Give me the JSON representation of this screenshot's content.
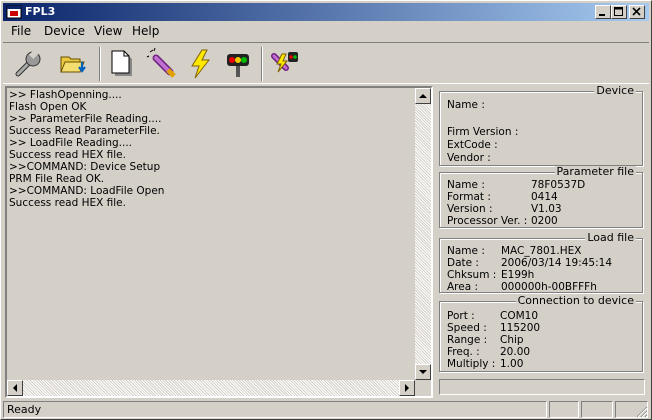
{
  "window": {
    "title": "FPL3"
  },
  "menu": {
    "file": "File",
    "device": "Device",
    "view": "View",
    "help": "Help"
  },
  "toolbar": {
    "buttons": [
      {
        "icon": "wrench-icon"
      },
      {
        "icon": "folder-open-icon"
      },
      {
        "icon": "blank-page-icon"
      },
      {
        "icon": "eraser-pen-icon"
      },
      {
        "icon": "lightning-icon"
      },
      {
        "icon": "traffic-light-icon"
      },
      {
        "icon": "auto-program-icon"
      }
    ]
  },
  "log": {
    "lines": [
      ">> FlashOpenning....",
      "Flash Open OK",
      ">> ParameterFile Reading....",
      "Success Read ParameterFile.",
      ">> LoadFile Reading....",
      "Success read HEX file.",
      ">>COMMAND: Device Setup",
      "PRM File Read OK.",
      ">>COMMAND: LoadFile Open",
      "Success read HEX file."
    ]
  },
  "device": {
    "legend": "Device",
    "name_label": "Name :",
    "firm_label": "Firm Version :",
    "extcode_label": "ExtCode :",
    "vendor_label": "Vendor :"
  },
  "parameter_file": {
    "legend": "Parameter file",
    "name_label": "Name :",
    "name": "78F0537D",
    "format_label": "Format :",
    "format": "0414",
    "version_label": "Version :",
    "version": "V1.03",
    "processor_label": "Processor Ver. :",
    "processor": "0200"
  },
  "load_file": {
    "legend": "Load file",
    "name_label": "Name :",
    "name": "MAC_7801.HEX",
    "date_label": "Date :",
    "date": "2006/03/14 19:45:14",
    "chksum_label": "Chksum :",
    "chksum": "E199h",
    "area_label": "Area :",
    "area": "000000h-00BFFFh"
  },
  "connection": {
    "legend": "Connection to device",
    "port_label": "Port :",
    "port": "COM10",
    "speed_label": "Speed :",
    "speed": "115200",
    "range_label": "Range :",
    "range": "Chip",
    "freq_label": "Freq. :",
    "freq": "20.00",
    "multiply_label": "Multiply :",
    "multiply": "1.00"
  },
  "progress": {
    "value": 0
  },
  "status": {
    "text": "Ready"
  },
  "colors": {
    "titlebar_start": "#0a246a",
    "titlebar_end": "#a6caf0",
    "face": "#d4d0c8"
  }
}
